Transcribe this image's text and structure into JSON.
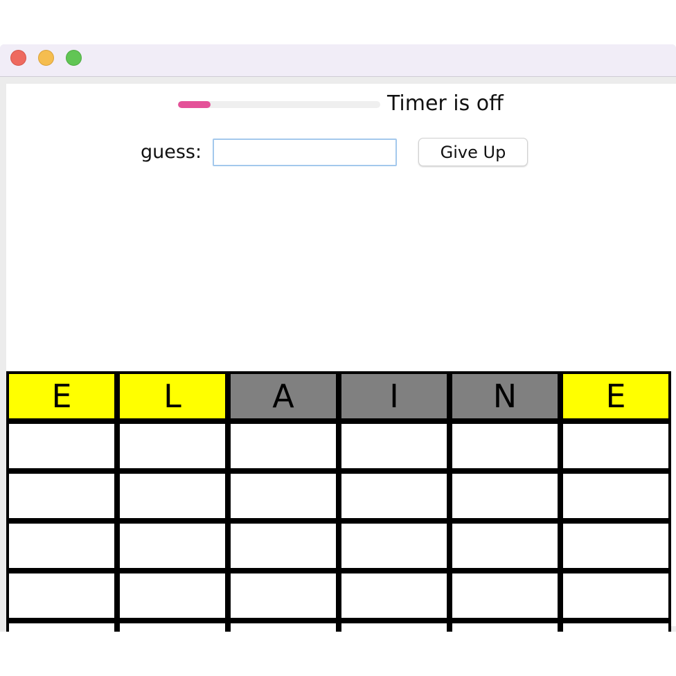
{
  "window": {
    "controls": [
      "close",
      "minimize",
      "maximize"
    ]
  },
  "timer": {
    "progress_fraction": 0.16,
    "progress_color": "#e45198",
    "status": "Timer is off"
  },
  "guess": {
    "label": "guess:",
    "value": "",
    "placeholder": ""
  },
  "give_up": {
    "label": "Give Up"
  },
  "colors": {
    "present": "#ffff00",
    "absent": "#808080",
    "empty": "#ffffff",
    "border": "#000000"
  },
  "board": {
    "rows": [
      [
        {
          "letter": "E",
          "state": "present"
        },
        {
          "letter": "L",
          "state": "present"
        },
        {
          "letter": "A",
          "state": "absent"
        },
        {
          "letter": "I",
          "state": "absent"
        },
        {
          "letter": "N",
          "state": "absent"
        },
        {
          "letter": "E",
          "state": "present"
        }
      ],
      [
        {
          "letter": "",
          "state": "empty"
        },
        {
          "letter": "",
          "state": "empty"
        },
        {
          "letter": "",
          "state": "empty"
        },
        {
          "letter": "",
          "state": "empty"
        },
        {
          "letter": "",
          "state": "empty"
        },
        {
          "letter": "",
          "state": "empty"
        }
      ],
      [
        {
          "letter": "",
          "state": "empty"
        },
        {
          "letter": "",
          "state": "empty"
        },
        {
          "letter": "",
          "state": "empty"
        },
        {
          "letter": "",
          "state": "empty"
        },
        {
          "letter": "",
          "state": "empty"
        },
        {
          "letter": "",
          "state": "empty"
        }
      ],
      [
        {
          "letter": "",
          "state": "empty"
        },
        {
          "letter": "",
          "state": "empty"
        },
        {
          "letter": "",
          "state": "empty"
        },
        {
          "letter": "",
          "state": "empty"
        },
        {
          "letter": "",
          "state": "empty"
        },
        {
          "letter": "",
          "state": "empty"
        }
      ],
      [
        {
          "letter": "",
          "state": "empty"
        },
        {
          "letter": "",
          "state": "empty"
        },
        {
          "letter": "",
          "state": "empty"
        },
        {
          "letter": "",
          "state": "empty"
        },
        {
          "letter": "",
          "state": "empty"
        },
        {
          "letter": "",
          "state": "empty"
        }
      ],
      [
        {
          "letter": "",
          "state": "empty"
        },
        {
          "letter": "",
          "state": "empty"
        },
        {
          "letter": "",
          "state": "empty"
        },
        {
          "letter": "",
          "state": "empty"
        },
        {
          "letter": "",
          "state": "empty"
        },
        {
          "letter": "",
          "state": "empty"
        }
      ]
    ]
  }
}
